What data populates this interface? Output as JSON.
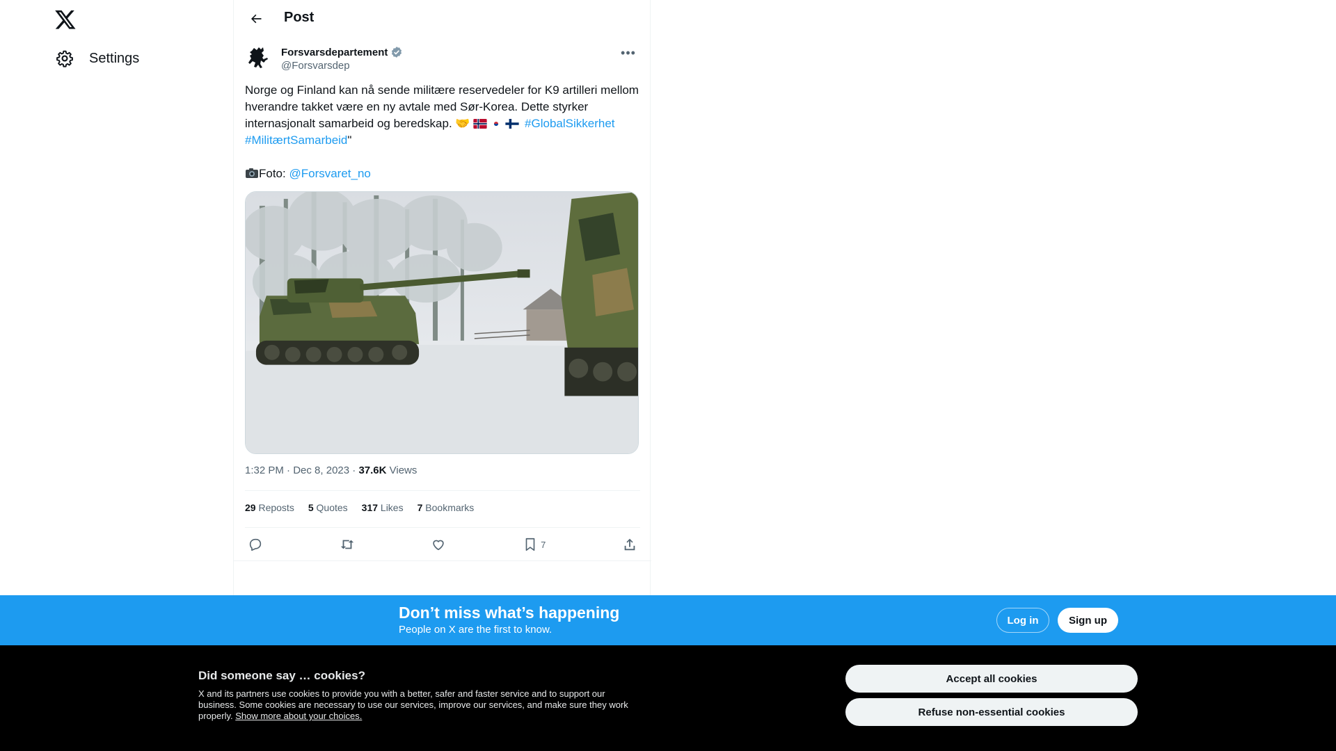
{
  "nav": {
    "logo_icon": "x-logo-icon",
    "settings_label": "Settings",
    "settings_icon": "gear-icon"
  },
  "header": {
    "back_icon": "arrow-left-icon",
    "title": "Post"
  },
  "tweet": {
    "author_name": "Forsvarsdepartement",
    "author_handle": "@Forsvarsdep",
    "verified": true,
    "text_line1": "Norge og Finland kan nå sende militære reservedeler for K9 artilleri mellom hverandre takket være en ny avtale med Sør-Korea. Dette styrker internasjonalt samarbeid og beredskap. 🤝",
    "hashtag1": "#GlobalSikkerhet",
    "hashtag2": "#MilitærtSamarbeid",
    "quote_end": "\"",
    "photo_prefix": "Foto: ",
    "mention": "@Forsvaret_no",
    "media_alt": "Image",
    "time": "1:32 PM",
    "date": "Dec 8, 2023",
    "separator": " · ",
    "views_count": "37.6K",
    "views_label": " Views",
    "reposts_count": "29",
    "reposts_label": " Reposts",
    "quotes_count": "5",
    "quotes_label": " Quotes",
    "likes_count": "317",
    "likes_label": " Likes",
    "bookmarks_count": "7",
    "bookmarks_label": " Bookmarks",
    "bookmark_action_count": "7"
  },
  "signup": {
    "title": "Don’t miss what’s happening",
    "subtitle": "People on X are the first to know.",
    "login_label": "Log in",
    "signup_label": "Sign up"
  },
  "cookies": {
    "title": "Did someone say … cookies?",
    "text": "X and its partners use cookies to provide you with a better, safer and faster service and to support our business. Some cookies are necessary to use our services, improve our services, and make sure they work properly. ",
    "link": "Show more about your choices.",
    "accept_label": "Accept all cookies",
    "refuse_label": "Refuse non-essential cookies"
  },
  "colors": {
    "accent": "#1d9bf0",
    "text": "#0f1419",
    "muted": "#536471"
  }
}
